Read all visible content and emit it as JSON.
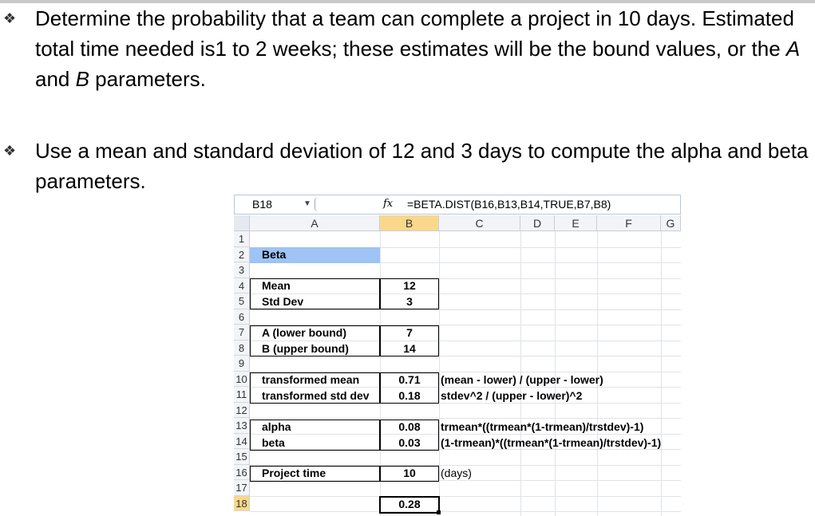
{
  "bullets": [
    {
      "marker": "❖",
      "parts": [
        {
          "t": "Determine the probability that a team can complete a project in 10 days. Estimated total time needed is1 to 2 weeks; these estimates will be the bound values, or the ",
          "i": false
        },
        {
          "t": "A",
          "i": true
        },
        {
          "t": " and ",
          "i": false
        },
        {
          "t": "B",
          "i": true
        },
        {
          "t": " parameters.",
          "i": false
        }
      ]
    },
    {
      "marker": "❖",
      "parts": [
        {
          "t": "Use a mean and standard deviation of 12 and 3 days to compute the alpha and beta parameters.",
          "i": false
        }
      ]
    }
  ],
  "spreadsheet": {
    "name_box": "B18",
    "fx": "fx",
    "formula": "=BETA.DIST(B16,B13,B14,TRUE,B7,B8)",
    "columns": [
      "A",
      "B",
      "C",
      "D",
      "E",
      "F",
      "G"
    ],
    "rows": [
      "1",
      "2",
      "3",
      "4",
      "5",
      "6",
      "7",
      "8",
      "9",
      "10",
      "11",
      "12",
      "13",
      "14",
      "15",
      "16",
      "17",
      "18"
    ],
    "cells": {
      "a2": "Beta",
      "a4": "Mean",
      "b4": "12",
      "a5": "Std Dev",
      "b5": "3",
      "a7": "A (lower bound)",
      "b7": "7",
      "a8": "B (upper bound)",
      "b8": "14",
      "a10": "transformed mean",
      "b10": "0.71",
      "c10": "(mean - lower) / (upper - lower)",
      "a11": "transformed std dev",
      "b11": "0.18",
      "c11": "stdev^2 / (upper - lower)^2",
      "a13": "alpha",
      "b13": "0.08",
      "c13": "trmean*((trmean*(1-trmean)/trstdev)-1)",
      "a14": "beta",
      "b14": "0.03",
      "c14": "(1-trmean)*((trmean*(1-trmean)/trstdev)-1)",
      "a16": "Project time",
      "b16": "10",
      "c16": "(days)",
      "b18": "0.28"
    }
  }
}
